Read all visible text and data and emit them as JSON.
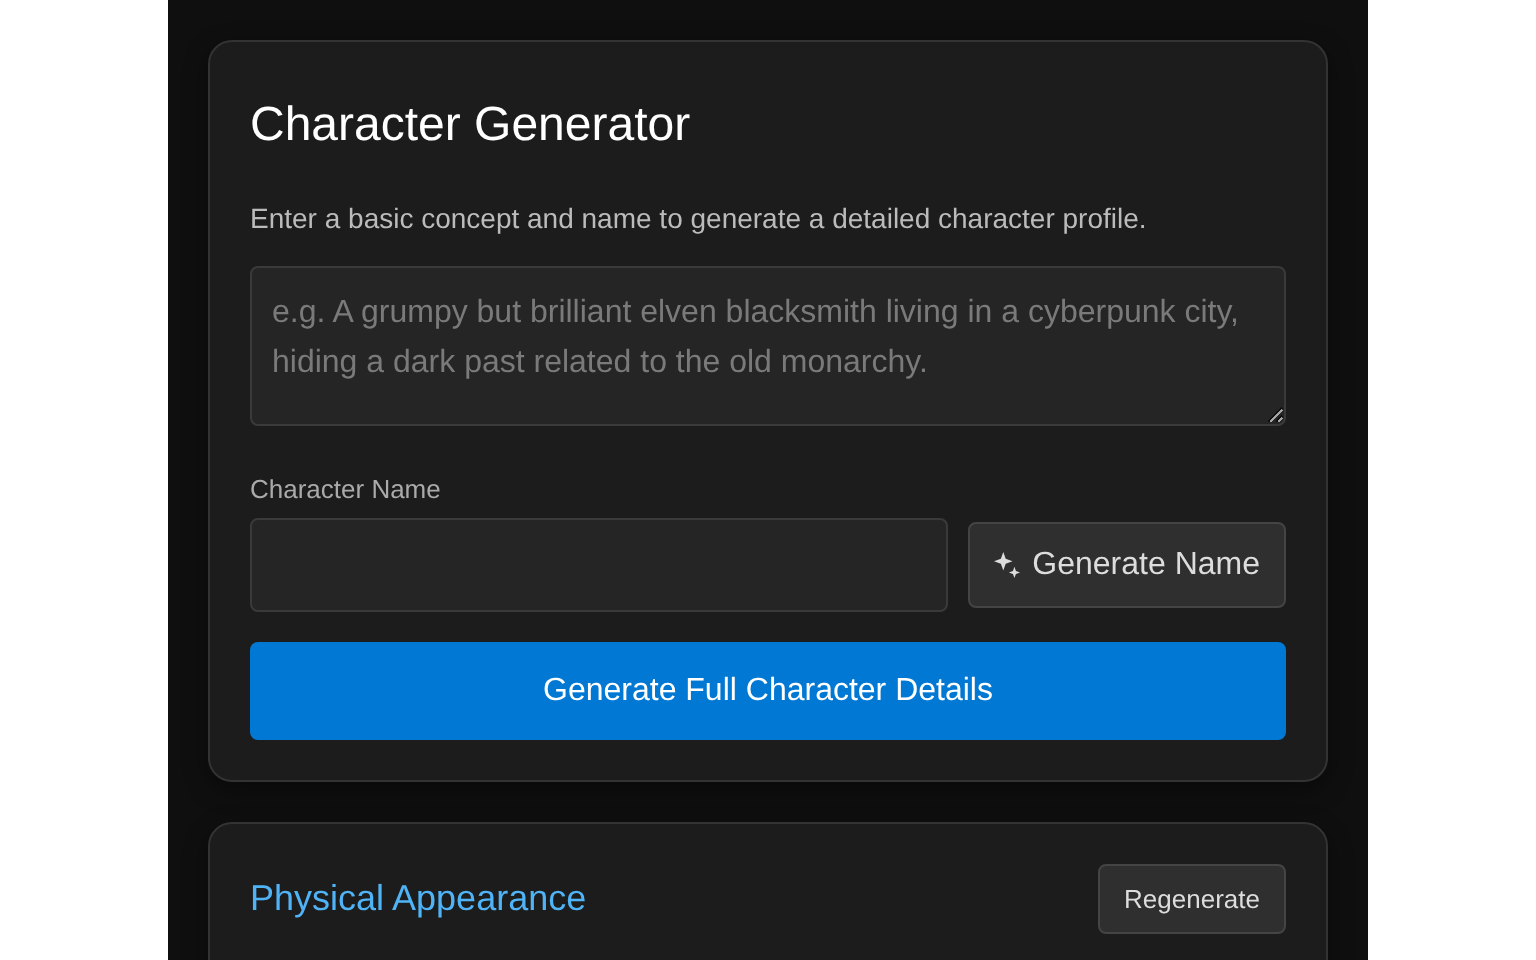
{
  "generator": {
    "title": "Character Generator",
    "description": "Enter a basic concept and name to generate a detailed character profile.",
    "concept_field": {
      "placeholder": "e.g. A grumpy but brilliant elven blacksmith living in a cyberpunk city, hiding a dark past related to the old monarchy."
    },
    "name_label": "Character Name",
    "generate_name_button": "Generate Name",
    "generate_button": "Generate Full Character Details"
  },
  "sections": [
    {
      "title": "Physical Appearance",
      "button": "Regenerate"
    }
  ]
}
